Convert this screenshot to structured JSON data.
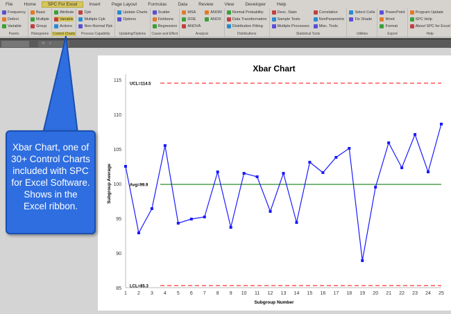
{
  "ribbon": {
    "tabs": [
      "File",
      "Home",
      "SPC For Excel",
      "Insert",
      "Page Layout",
      "Formulas",
      "Data",
      "Review",
      "View",
      "Developer",
      "Help"
    ],
    "active_tab": "SPC For Excel",
    "groups": [
      {
        "label": "Pareto",
        "cols": [
          [
            "Frequency",
            "Defect",
            "Variable"
          ]
        ]
      },
      {
        "label": "Histograms",
        "cols": [
          [
            "Basic",
            "Multiple",
            "Group"
          ]
        ]
      },
      {
        "label": "Control Charts",
        "cols": [
          [
            "Attribute",
            "Variable",
            "Actions"
          ]
        ],
        "highlight": true
      },
      {
        "label": "Process Capability",
        "cols": [
          [
            "Cpk",
            "Multiple Cpk",
            "Non-Normal Ppk"
          ]
        ]
      },
      {
        "label": "Updating/Options",
        "cols": [
          [
            "Update Charts",
            "Options"
          ]
        ]
      },
      {
        "label": "Cause and Effect",
        "cols": [
          [
            "Scatter",
            "Fishbone",
            "Regression"
          ]
        ]
      },
      {
        "label": "Analysis",
        "cols": [
          [
            "MSA",
            "DOE",
            "ANOVA"
          ],
          [
            "ANOM",
            "ANOX"
          ]
        ]
      },
      {
        "label": "Distributions",
        "cols": [
          [
            "Normal Probability",
            "Data Transformation",
            "Distribution Fitting"
          ]
        ]
      },
      {
        "label": "Statistical Tools",
        "cols": [
          [
            "Desc. Stats",
            "Sample Tests",
            "Multiple Processes"
          ],
          [
            "Correlation",
            "NonParametric",
            "Misc. Tools"
          ]
        ]
      },
      {
        "label": "Utilities",
        "cols": [
          [
            "Select Cells",
            "Fix Shade"
          ]
        ]
      },
      {
        "label": "Export",
        "cols": [
          [
            "PowerPoint",
            "Word",
            "Format"
          ]
        ]
      },
      {
        "label": "Help",
        "cols": [
          [
            "Program Update",
            "SPC Help",
            "About SPC for Excel"
          ]
        ]
      }
    ]
  },
  "formula_bar": {
    "cancel": "✕",
    "enter": "✓"
  },
  "callout": {
    "text": "Xbar Chart, one of 30+ Control Charts included with SPC for Excel Software. Shows in the Excel ribbon.",
    "color": "#2f6ee0"
  },
  "chart_data": {
    "type": "line",
    "title": "Xbar Chart",
    "xlabel": "Subgroup Number",
    "ylabel": "Subgroup Average",
    "x": [
      1,
      2,
      3,
      4,
      5,
      6,
      7,
      8,
      9,
      10,
      11,
      12,
      13,
      14,
      15,
      16,
      17,
      18,
      19,
      20,
      21,
      22,
      23,
      24,
      25
    ],
    "values": [
      102.5,
      92.9,
      96.4,
      105.5,
      94.3,
      94.9,
      95.2,
      101.7,
      93.7,
      101.5,
      101.0,
      96.0,
      101.5,
      94.4,
      103.1,
      101.6,
      103.8,
      105.1,
      88.9,
      99.5,
      105.9,
      102.3,
      107.1,
      101.7,
      108.6
    ],
    "ylim": [
      85,
      115
    ],
    "yticks": [
      85,
      90,
      95,
      100,
      105,
      110,
      115
    ],
    "lines": [
      {
        "label": "UCL=114.5",
        "value": 114.5,
        "color": "#ff3333",
        "style": "dashed"
      },
      {
        "label": "Avg=99.9",
        "value": 99.9,
        "color": "#2a8a2a",
        "style": "solid"
      },
      {
        "label": "LCL=85.3",
        "value": 85.3,
        "color": "#ff3333",
        "style": "dashed"
      }
    ],
    "series_color": "#1a1aff",
    "grid": false
  }
}
